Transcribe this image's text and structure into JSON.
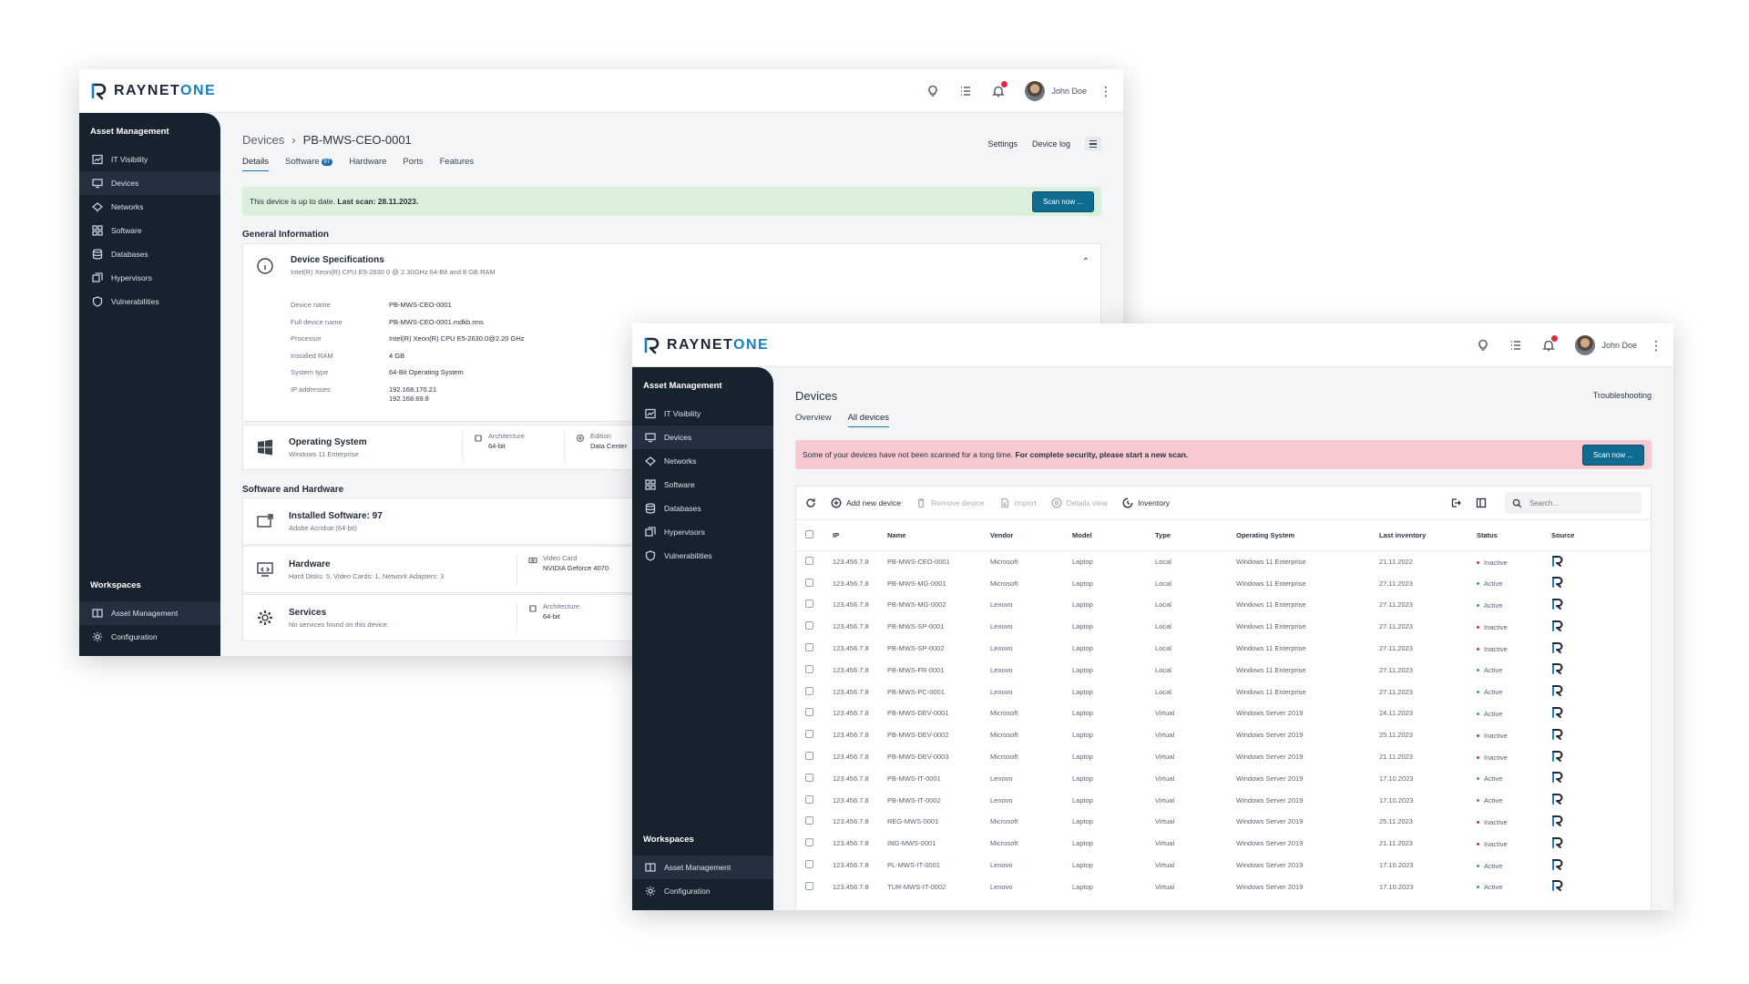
{
  "brand": {
    "name_a": "RAYNET",
    "name_b": "ONE"
  },
  "user": {
    "name": "John Doe"
  },
  "colors": {
    "sidebar": "#17222f",
    "accent": "#1a6fb0",
    "active_status": "#2cae5b",
    "inactive_status": "#e0263b",
    "ok_banner": "#dbf0dc",
    "warn_banner": "#f8c9d0",
    "notification": "#e0263b"
  },
  "topbar_icons": [
    "lightbulb-icon",
    "list-icon",
    "bell-icon",
    "more-vertical-icon"
  ],
  "sidebar": {
    "title": "Asset Management",
    "items": [
      {
        "label": "IT Visibility",
        "icon": "chart-icon"
      },
      {
        "label": "Devices",
        "icon": "monitor-icon"
      },
      {
        "label": "Networks",
        "icon": "network-icon"
      },
      {
        "label": "Software",
        "icon": "grid-icon"
      },
      {
        "label": "Databases",
        "icon": "database-icon"
      },
      {
        "label": "Hypervisors",
        "icon": "layers-icon"
      },
      {
        "label": "Vulnerabilities",
        "icon": "shield-icon"
      }
    ],
    "workspaces_title": "Workspaces",
    "workspaces": [
      {
        "label": "Asset Management",
        "icon": "book-icon"
      },
      {
        "label": "Configuration",
        "icon": "gear-icon"
      }
    ]
  },
  "detail": {
    "breadcrumb_parent": "Devices",
    "breadcrumb_sep": "›",
    "breadcrumb_current": "PB-MWS-CEO-0001",
    "tabs": [
      {
        "label": "Details"
      },
      {
        "label": "Software",
        "badge": "97"
      },
      {
        "label": "Hardware"
      },
      {
        "label": "Ports"
      },
      {
        "label": "Features"
      }
    ],
    "links": {
      "settings": "Settings",
      "device_log": "Device log"
    },
    "banner": {
      "text": "This device is up to date.",
      "bold": "Last scan: 28.11.2023.",
      "button": "Scan now ..."
    },
    "general_title": "General Information",
    "spec": {
      "title": "Device Specifications",
      "subtitle": "Intel(R) Xeon(R) CPU E5-2630 0 @ 2.30GHz 64-Bit and 8 GB RAM",
      "fields": [
        {
          "k": "Device name",
          "v": "PB-MWS-CEO-0001"
        },
        {
          "k": "Full device name",
          "v": "PB-MWS-CEO-0001.mdkb.rms"
        },
        {
          "k": "Processor",
          "v": "Intel(R) Xeon(R) CPU E5-2630.0@2.20 GHz"
        },
        {
          "k": "Installed RAM",
          "v": "4 GB"
        },
        {
          "k": "System type",
          "v": "64-Bit Operating System"
        },
        {
          "k": "IP addresses",
          "v": "192.168.170.21",
          "v2": "192.168.69.8"
        }
      ]
    },
    "os": {
      "title": "Operating System",
      "sub": "Windows 11 Enterprise",
      "arch_label": "Architecture",
      "arch_value": "64-bit",
      "edition_label": "Edition",
      "edition_value": "Data Center"
    },
    "sw_hw_title": "Software and Hardware",
    "installed": {
      "title": "Installed Software: 97",
      "sub": "Adobe Acrobat (64-bit)"
    },
    "hardware": {
      "title": "Hardware",
      "sub": "Hard Disks: 5, Video Cards: 1, Network Adapters: 3",
      "video_label": "Video Card",
      "video_value": "NVIDIA Geforce 4070"
    },
    "services": {
      "title": "Services",
      "sub": "No services found on this device.",
      "arch_label": "Architecture",
      "arch_value": "64-bit"
    }
  },
  "list": {
    "title": "Devices",
    "troubleshooting": "Troubleshooting",
    "tabs": [
      {
        "label": "Overview"
      },
      {
        "label": "All devices"
      }
    ],
    "banner": {
      "text": "Some of your devices have not been scanned for a long time.",
      "bold": "For complete security, please start a new scan.",
      "button": "Scan now ..."
    },
    "toolbar": {
      "add": "Add new device",
      "remove": "Remove device",
      "import": "Import",
      "details": "Details view",
      "inventory": "Inventory",
      "search_placeholder": "Search..."
    },
    "columns": [
      "IP",
      "Name",
      "Vendor",
      "Model",
      "Type",
      "Operating System",
      "Last inventory",
      "Status",
      "Source"
    ],
    "rows": [
      [
        "123.456.7.8",
        "PB-MWS-CEO-0001",
        "Microsoft",
        "Laptop",
        "Local",
        "Windows 11 Enterprise",
        "21.11.2022",
        "Inactive"
      ],
      [
        "123.456.7.8",
        "PB-MWS-MG-0001",
        "Microsoft",
        "Laptop",
        "Local",
        "Windows 11 Enterprise",
        "27.11.2023",
        "Active"
      ],
      [
        "123.456.7.8",
        "PB-MWS-MG-0002",
        "Lenovo",
        "Laptop",
        "Local",
        "Windows 11 Enterprise",
        "27.11.2023",
        "Active"
      ],
      [
        "123.456.7.8",
        "PB-MWS-SP-0001",
        "Lenovo",
        "Laptop",
        "Local",
        "Windows 11 Enterprise",
        "27.11.2023",
        "Inactive"
      ],
      [
        "123.456.7.8",
        "PB-MWS-SP-0002",
        "Lenovo",
        "Laptop",
        "Local",
        "Windows 11 Enterprise",
        "27.11.2023",
        "Inactive"
      ],
      [
        "123.456.7.8",
        "PB-MWS-FR-0001",
        "Lenovo",
        "Laptop",
        "Local",
        "Windows 11 Enterprise",
        "27.11.2023",
        "Active"
      ],
      [
        "123.456.7.8",
        "PB-MWS-PC-0001",
        "Lenovo",
        "Laptop",
        "Local",
        "Windows 11 Enterprise",
        "27.11.2023",
        "Active"
      ],
      [
        "123.456.7.8",
        "PB-MWS-DEV-0001",
        "Microsoft",
        "Laptop",
        "Virtual",
        "Windows Server 2019",
        "24.11.2023",
        "Active"
      ],
      [
        "123.456.7.8",
        "PB-MWS-DEV-0002",
        "Microsoft",
        "Laptop",
        "Virtual",
        "Windows Server 2019",
        "25.11.2023",
        "Inactive"
      ],
      [
        "123.456.7.8",
        "PB-MWS-DEV-0003",
        "Microsoft",
        "Laptop",
        "Virtual",
        "Windows Server 2019",
        "21.11.2023",
        "Inactive"
      ],
      [
        "123.456.7.8",
        "PB-MWS-IT-0001",
        "Lenovo",
        "Laptop",
        "Virtual",
        "Windows Server 2019",
        "17.10.2023",
        "Active"
      ],
      [
        "123.456.7.8",
        "PB-MWS-IT-0002",
        "Lenovo",
        "Laptop",
        "Virtual",
        "Windows Server 2019",
        "17.10.2023",
        "Active"
      ],
      [
        "123.456.7.8",
        "REG-MWS-0001",
        "Microsoft",
        "Laptop",
        "Virtual",
        "Windows Server 2019",
        "25.11.2023",
        "Inactive"
      ],
      [
        "123.456.7.8",
        "ING-MWS-0001",
        "Microsoft",
        "Laptop",
        "Virtual",
        "Windows Server 2019",
        "21.11.2023",
        "Inactive"
      ],
      [
        "123.456.7.8",
        "PL-MWS-IT-0001",
        "Lenovo",
        "Laptop",
        "Virtual",
        "Windows Server 2019",
        "17.10.2023",
        "Active"
      ],
      [
        "123.456.7.8",
        "TUR-MWS-IT-0002",
        "Lenovo",
        "Laptop",
        "Virtual",
        "Windows Server 2019",
        "17.10.2023",
        "Active"
      ]
    ]
  }
}
